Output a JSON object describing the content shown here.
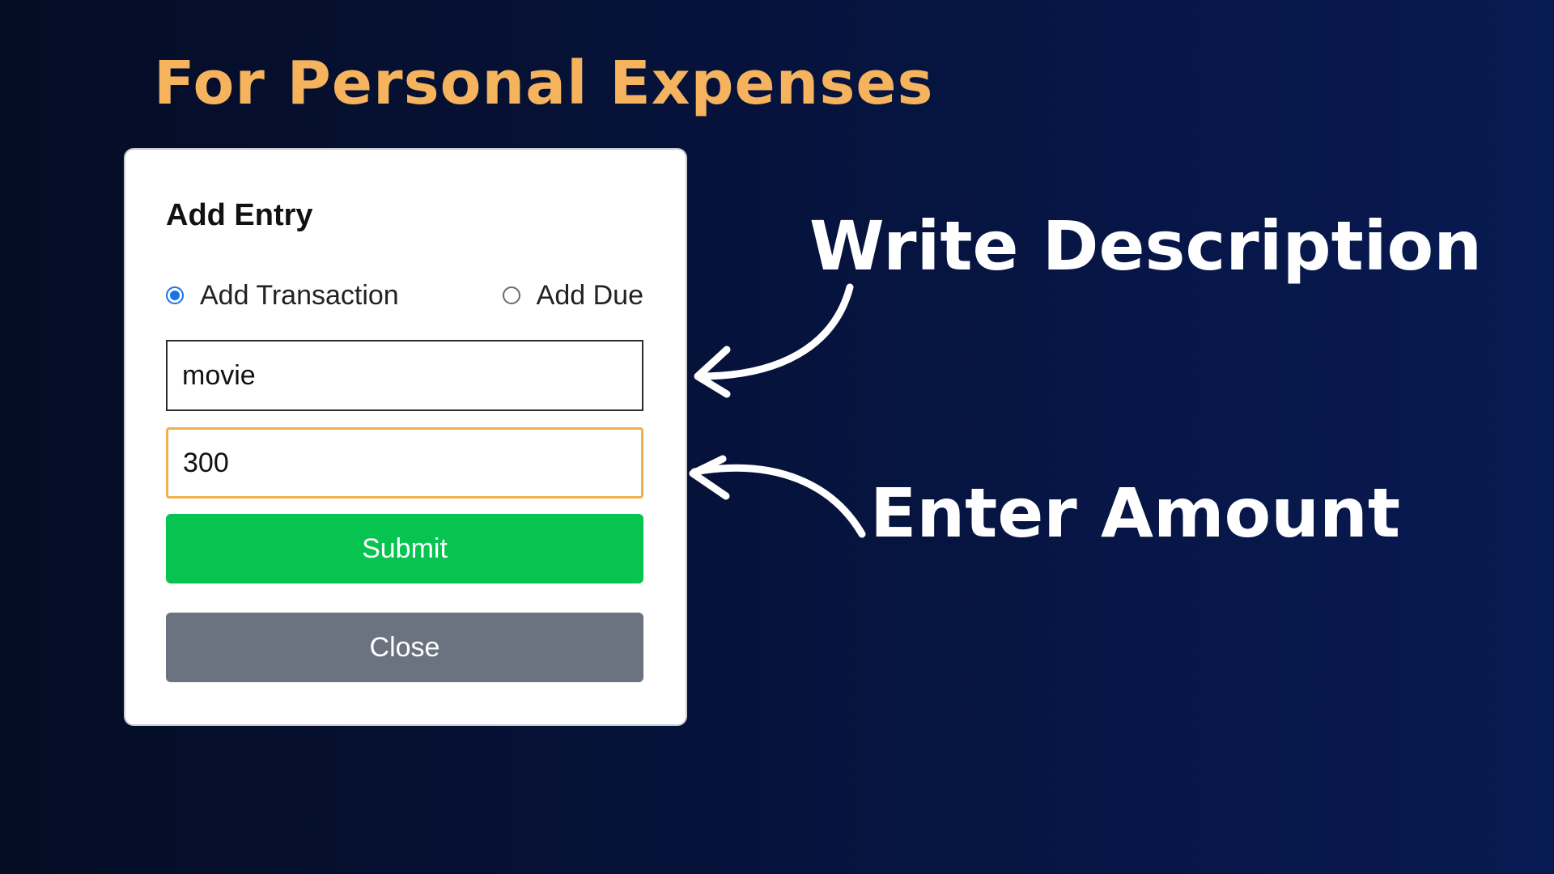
{
  "headline": "For Personal Expenses",
  "dialog": {
    "title": "Add Entry",
    "options": [
      {
        "label": "Add Transaction",
        "checked": true
      },
      {
        "label": "Add Due",
        "checked": false
      }
    ],
    "description_value": "movie",
    "amount_value": "300",
    "submit_label": "Submit",
    "close_label": "Close"
  },
  "annotations": {
    "description": "Write  Description",
    "amount": "Enter Amount"
  },
  "colors": {
    "headline": "#f6b35e",
    "submit": "#07c451",
    "close": "#6b7280",
    "radio_checked": "#1a73e8",
    "amount_focus_border": "#f0b04a"
  },
  "icons": {
    "description_arrow": "curved-arrow-left-icon",
    "amount_arrow": "curved-arrow-left-icon"
  }
}
